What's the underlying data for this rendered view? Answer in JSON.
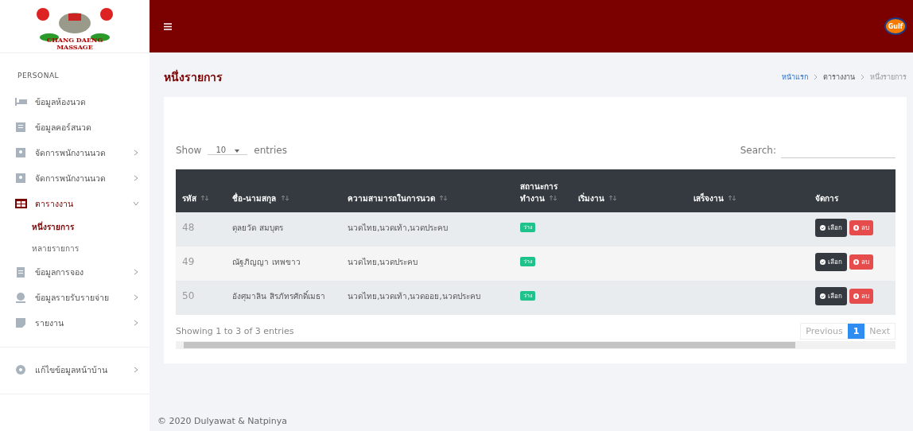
{
  "logo": {
    "line1": "CHANG DAENG",
    "line2": "MASSAGE"
  },
  "sidebar": {
    "heading": "PERSONAL",
    "items": [
      {
        "label": "ข้อมูลห้องนวด",
        "expandable": false,
        "selected": false
      },
      {
        "label": "ข้อมูลคอร์สนวด",
        "expandable": false,
        "selected": false
      },
      {
        "label": "จัดการพนักงานนวด",
        "expandable": true,
        "expanded": false,
        "selected": false
      },
      {
        "label": "จัดการพนักงานนวด",
        "expandable": true,
        "expanded": false,
        "selected": false
      },
      {
        "label": "ตารางงาน",
        "expandable": true,
        "expanded": true,
        "selected": true,
        "children": [
          {
            "label": "หนึ่งรายการ",
            "selected": true
          },
          {
            "label": "หลายรายการ",
            "selected": false
          }
        ]
      },
      {
        "label": "ข้อมูลการจอง",
        "expandable": true,
        "expanded": false,
        "selected": false
      },
      {
        "label": "ข้อมูลรายรับรายจ่าย",
        "expandable": true,
        "expanded": false,
        "selected": false
      },
      {
        "label": "รายงาน",
        "expandable": true,
        "expanded": false,
        "selected": false
      }
    ],
    "footer_item": {
      "label": "แก้ไขข้อมูลหน้าบ้าน",
      "expandable": true
    }
  },
  "topbar": {
    "brand_badge": "Gulf"
  },
  "page": {
    "title": "หนึ่งรายการ",
    "breadcrumb": [
      {
        "label": "หน้าแรก",
        "kind": "link"
      },
      {
        "label": "ตารางงาน",
        "kind": "text"
      },
      {
        "label": "หนึ่งรายการ",
        "kind": "current"
      }
    ]
  },
  "table_controls": {
    "show_label": "Show",
    "page_size": "10",
    "entries_label": "entries",
    "search_label": "Search:"
  },
  "table": {
    "columns": [
      "รหัส",
      "ชื่อ-นามสกุล",
      "ความสามารถในการนวด",
      "สถานะการทำงาน",
      "เริ่มงาน",
      "เสร็จงาน",
      "จัดการ"
    ],
    "rows": [
      {
        "id": "48",
        "name": "ดุลยวัด สมบุตร",
        "skills": "นวดไทย,นวดเท้า,นวดประคบ",
        "status": "ว่าง",
        "select": "เลือก",
        "delete": "ลบ"
      },
      {
        "id": "49",
        "name": "ณัฐภิญญา เทพขาว",
        "skills": "นวดไทย,นวดประคบ",
        "status": "ว่าง",
        "select": "เลือก",
        "delete": "ลบ"
      },
      {
        "id": "50",
        "name": "อังศุมาลิน สิรภัทรศักดิ์เมธา",
        "skills": "นวดไทย,นวดเท้า,นวดออย,นวดประคบ",
        "status": "ว่าง",
        "select": "เลือก",
        "delete": "ลบ"
      }
    ]
  },
  "table_info": "Showing 1 to 3 of 3 entries",
  "pagination": [
    {
      "label": "Previous",
      "kind": "nav",
      "selected": false
    },
    {
      "label": "1",
      "kind": "page",
      "selected": true
    },
    {
      "label": "Next",
      "kind": "nav",
      "selected": false
    }
  ],
  "footer": "© 2020 Dulyawat & Natpinya"
}
